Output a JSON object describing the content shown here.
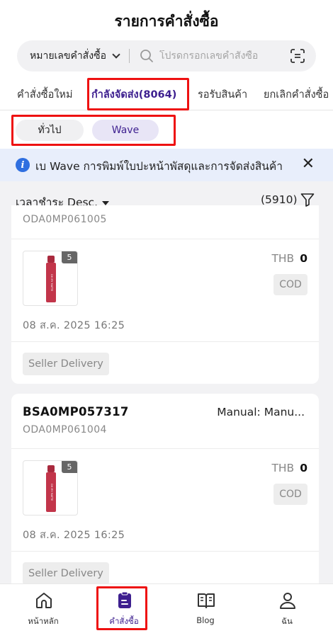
{
  "header": {
    "title": "รายการคำสั่งซื้อ",
    "search_type": "หมายเลขคำสั่งซื้อ",
    "search_placeholder": "โปรดกรอกเลขคำสั่งซื้อ"
  },
  "tabs": [
    {
      "label": "คำสั่งซื้อใหม่"
    },
    {
      "label": "กำลังจัดส่ง(8064)"
    },
    {
      "label": "รอรับสินค้า"
    },
    {
      "label": "ยกเลิกคำสั่งซื้อ"
    }
  ],
  "segments": {
    "all": "ทั่วไป",
    "wave": "Wave"
  },
  "banner": {
    "text": "เบ Wave การพิมพ์ใบปะหน้าพัสดุและการจัดส่งสินค้า"
  },
  "sort": {
    "label": "เวลาชำระ Desc.",
    "count": "(5910)"
  },
  "orders": [
    {
      "sub_id": "ODA0MP061005",
      "qty": "5",
      "currency": "THB",
      "amount": "0",
      "payment": "COD",
      "date": "08 ส.ค. 2025 16:25",
      "tag": "Seller Delivery"
    },
    {
      "id": "BSA0MP057317",
      "manual": "Manual: Manu...",
      "sub_id": "ODA0MP061004",
      "qty": "5",
      "currency": "THB",
      "amount": "0",
      "payment": "COD",
      "date": "08 ส.ค. 2025 16:25",
      "tag": "Seller Delivery"
    }
  ],
  "product_label": "OH MY MATTE",
  "bottom_nav": [
    {
      "label": "หน้าหลัก",
      "icon": "home-icon"
    },
    {
      "label": "คำสั่งซื้อ",
      "icon": "orders-icon"
    },
    {
      "label": "Blog",
      "icon": "book-icon"
    },
    {
      "label": "ฉัน",
      "icon": "user-icon"
    }
  ],
  "colors": {
    "accent": "#3d1f8f",
    "highlight": "#e11111",
    "info": "#2f6fe0",
    "lipstick": "#c2354a"
  }
}
